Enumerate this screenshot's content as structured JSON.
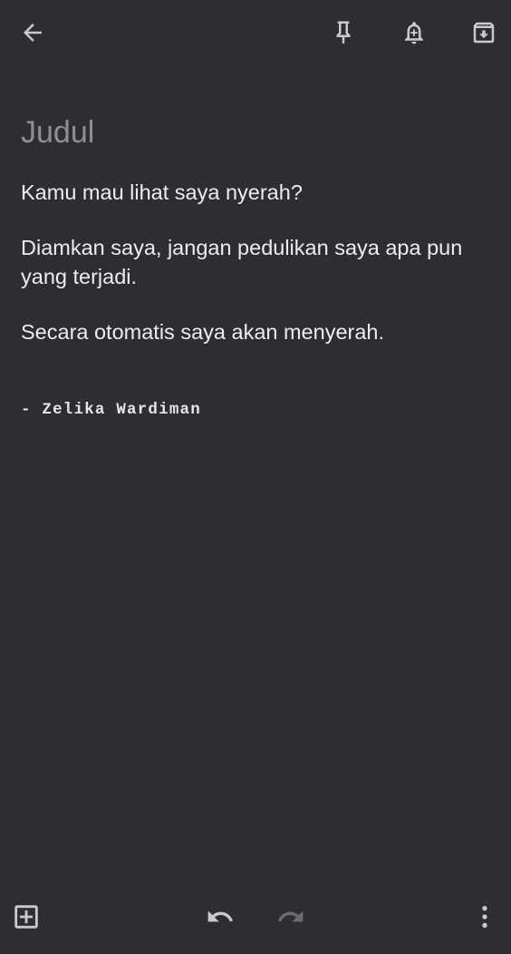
{
  "header": {
    "back_icon": "arrow-left-icon",
    "pin_icon": "pin-icon",
    "reminder_icon": "bell-plus-icon",
    "archive_icon": "archive-icon"
  },
  "note": {
    "title_placeholder": "Judul",
    "paragraphs": [
      "Kamu mau lihat saya nyerah?",
      "Diamkan saya, jangan pedulikan saya apa pun yang terjadi.",
      "Secara otomatis saya akan menyerah."
    ],
    "signature": "- Zelika Wardiman"
  },
  "footer": {
    "add_icon": "add-box-icon",
    "undo_icon": "undo-icon",
    "redo_icon": "redo-icon",
    "more_icon": "more-vertical-icon"
  },
  "colors": {
    "background": "#2d2e32",
    "icon": "#c9cacd",
    "icon_disabled": "#6b6d72",
    "placeholder": "#8d8f94",
    "text": "#ededef"
  }
}
